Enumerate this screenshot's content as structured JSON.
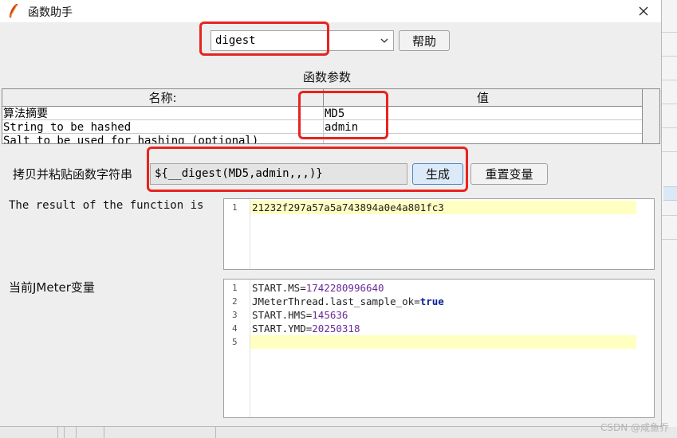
{
  "window": {
    "title": "函数助手",
    "close_icon": "close-icon",
    "app_icon": "feather-icon"
  },
  "function_selector": {
    "value": "digest",
    "help_label": "帮助"
  },
  "parameters": {
    "title": "函数参数",
    "columns": [
      "名称:",
      "值"
    ],
    "rows": [
      {
        "name": "算法摘要",
        "value": "MD5"
      },
      {
        "name": "String to be hashed",
        "value": "admin"
      },
      {
        "name": "Salt to be used for hashing (optional)",
        "value": ""
      }
    ]
  },
  "function_string": {
    "label": "拷贝并粘贴函数字符串",
    "value": "${__digest(MD5,admin,,,)}",
    "generate_label": "生成",
    "reset_label": "重置变量"
  },
  "result": {
    "label": "The result of the function is",
    "line_numbers": [
      "1"
    ],
    "lines": [
      "21232f297a57a5a743894a0e4a801fc3"
    ]
  },
  "variables": {
    "label": "当前JMeter变量",
    "line_numbers": [
      "1",
      "2",
      "3",
      "4",
      "5"
    ],
    "lines": [
      {
        "key": "START.MS=",
        "value": "1742280996640",
        "type": "number"
      },
      {
        "key": "JMeterThread.last_sample_ok=",
        "value": "true",
        "type": "keyword"
      },
      {
        "key": "START.HMS=",
        "value": "145636",
        "type": "number"
      },
      {
        "key": "START.YMD=",
        "value": "20250318",
        "type": "number"
      },
      {
        "key": "",
        "value": "",
        "type": "empty"
      }
    ]
  },
  "watermark": "CSDN @咸鱼乔",
  "colors": {
    "highlight_box": "#e8231f",
    "current_line": "#ffffc2",
    "number": "#6a2a9a",
    "keyword": "#0a1f9a"
  }
}
